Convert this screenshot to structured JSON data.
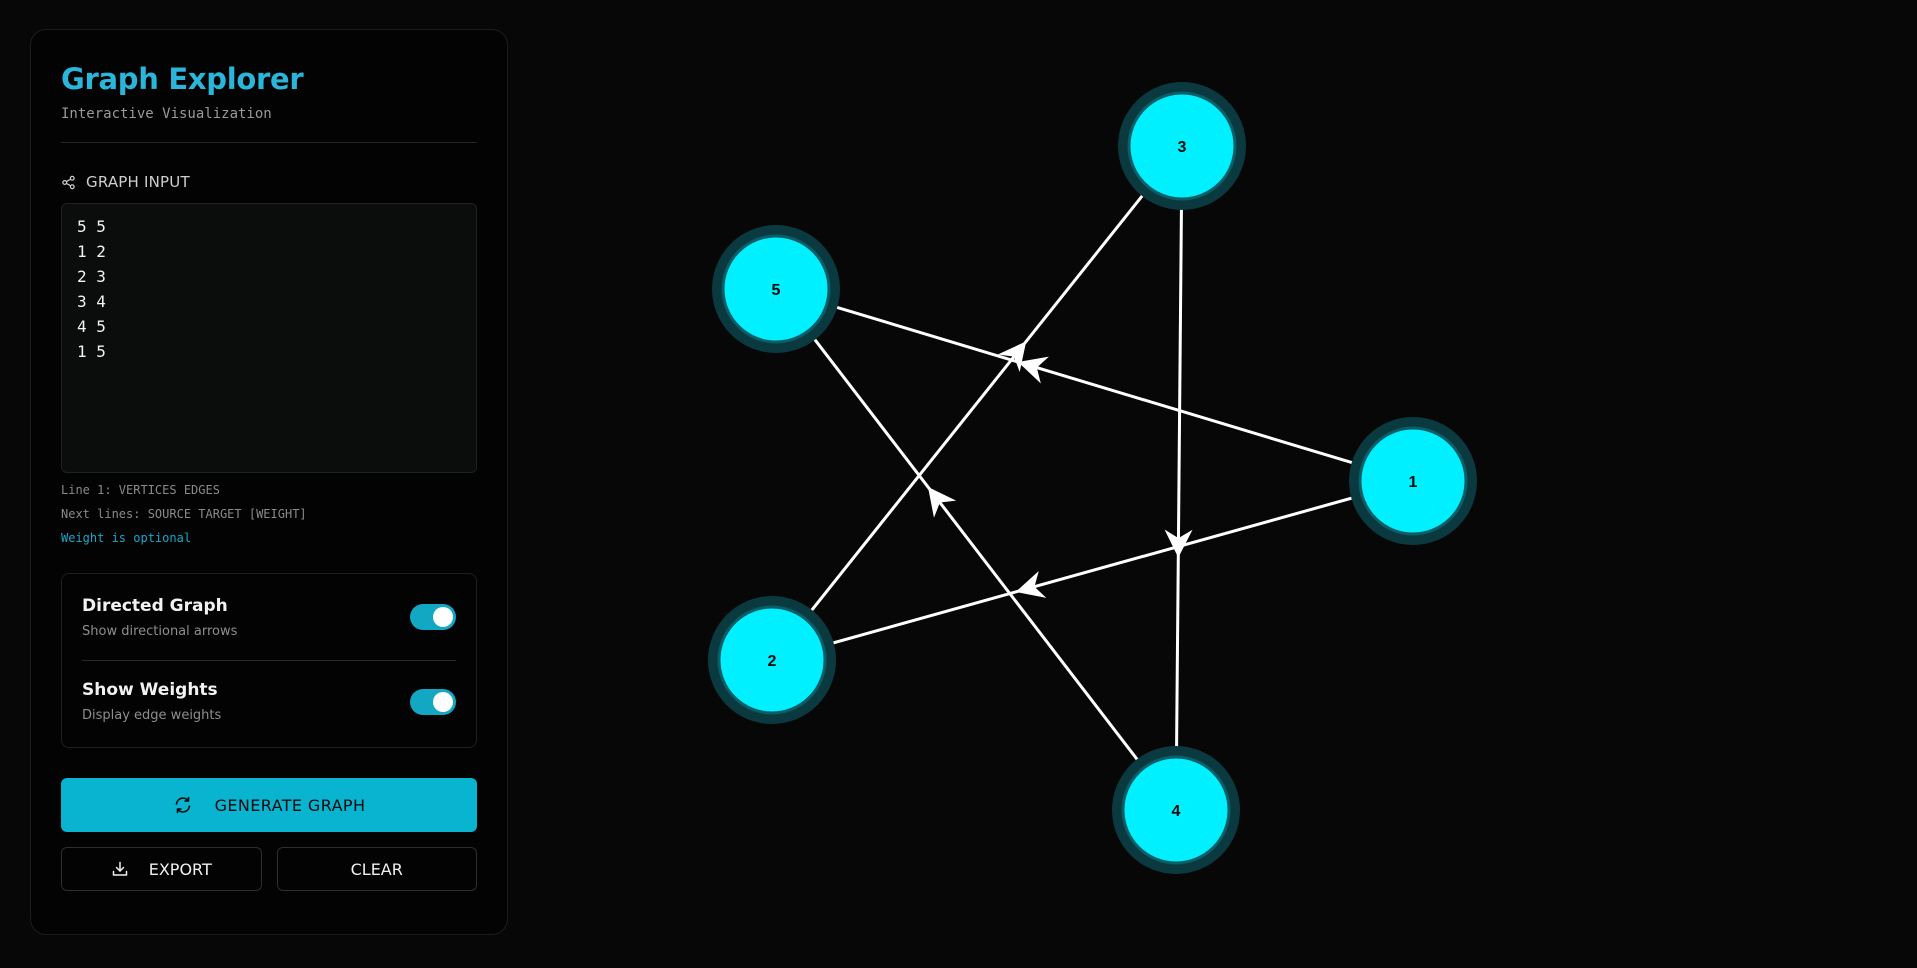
{
  "app": {
    "title": "Graph Explorer",
    "subtitle": "Interactive Visualization"
  },
  "input": {
    "label": "GRAPH INPUT",
    "icon": "share-icon",
    "lines": [
      "5 5",
      "1 2",
      "2 3",
      "3 4",
      "4 5",
      "1 5"
    ]
  },
  "hints": {
    "line1": "Line 1: VERTICES EDGES",
    "line2": "Next lines: SOURCE TARGET [WEIGHT]",
    "line3": "Weight is optional"
  },
  "toggles": [
    {
      "title": "Directed Graph",
      "desc": "Show directional arrows",
      "on": true
    },
    {
      "title": "Show Weights",
      "desc": "Display edge weights",
      "on": true
    }
  ],
  "buttons": {
    "generate": "GENERATE GRAPH",
    "export": "EXPORT",
    "clear": "CLEAR"
  },
  "graph": {
    "nodes": [
      "1",
      "2",
      "3",
      "4",
      "5"
    ],
    "edges": [
      [
        "1",
        "2"
      ],
      [
        "2",
        "3"
      ],
      [
        "3",
        "4"
      ],
      [
        "4",
        "5"
      ],
      [
        "1",
        "5"
      ]
    ],
    "node_color": "#00f0ff",
    "edge_color": "#ffffff",
    "accent": "#08b4d0"
  }
}
